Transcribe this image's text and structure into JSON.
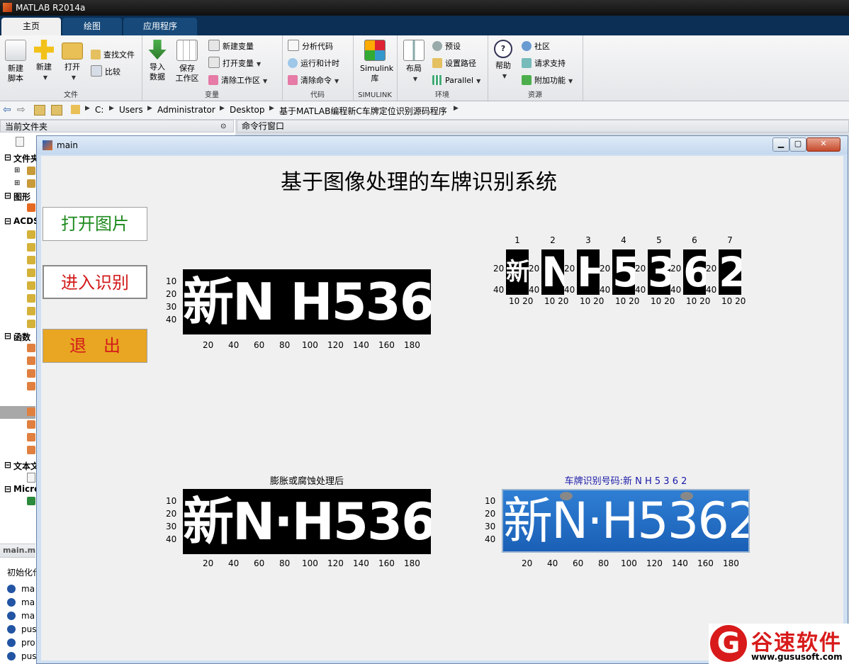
{
  "app": {
    "title": "MATLAB R2014a"
  },
  "tabs": [
    {
      "label": "主页",
      "active": true
    },
    {
      "label": "绘图",
      "active": false
    },
    {
      "label": "应用程序",
      "active": false
    }
  ],
  "ribbon": {
    "file": {
      "label": "文件",
      "new_script": "新建\n脚本",
      "new": "新建",
      "open": "打开",
      "find_files": "查找文件",
      "compare": "比较"
    },
    "variable": {
      "label": "变量",
      "import": "导入\n数据",
      "save": "保存\n工作区",
      "new_var": "新建变量",
      "open_var": "打开变量",
      "clear_ws": "清除工作区"
    },
    "code": {
      "label": "代码",
      "analyze": "分析代码",
      "run_time": "运行和计时",
      "clear_cmd": "清除命令"
    },
    "simulink": {
      "label": "SIMULINK",
      "lib": "Simulink\n库"
    },
    "env": {
      "label": "环境",
      "layout": "布局",
      "prefs": "预设",
      "set_path": "设置路径",
      "parallel": "Parallel"
    },
    "resources": {
      "label": "资源",
      "help": "帮助",
      "community": "社区",
      "support": "请求支持",
      "addons": "附加功能"
    }
  },
  "path": [
    "C:",
    "Users",
    "Administrator",
    "Desktop",
    "基于MATLAB编程新C车牌定位识别源码程序"
  ],
  "left_panel": {
    "title": "当前文件夹",
    "tree": [
      "文件夹",
      "图形",
      "ACDS",
      "函数",
      "文本文",
      "Micro"
    ],
    "file_header": "main.m",
    "init_text": "初始化代",
    "files": [
      "ma",
      "ma",
      "ma",
      "pus",
      "pro",
      "pus"
    ]
  },
  "command_window": {
    "title": "命令行窗口"
  },
  "figure": {
    "window_title": "main",
    "heading": "基于图像处理的车牌识别系统",
    "buttons": [
      {
        "label": "打开图片",
        "color": "#1e8a1e",
        "bg": "#ffffff"
      },
      {
        "label": "进入识别",
        "color": "#d21a1a",
        "bg": "#ffffff"
      },
      {
        "label": "退　出",
        "color": "#d21a1a",
        "bg": "#e9a622"
      }
    ],
    "plate_text": "新N H5362",
    "plate_text_dot": "新N·H5362",
    "axes_binary": {
      "yticks": [
        "10",
        "20",
        "30",
        "40"
      ],
      "xticks": [
        "20",
        "40",
        "60",
        "80",
        "100",
        "120",
        "140",
        "160",
        "180"
      ]
    },
    "axes_morph": {
      "title": "膨胀或腐蚀处理后",
      "yticks": [
        "10",
        "20",
        "30",
        "40"
      ],
      "xticks": [
        "20",
        "40",
        "60",
        "80",
        "100",
        "120",
        "140",
        "160",
        "180"
      ]
    },
    "axes_color": {
      "title": "车牌识别号码:新 N H 5 3 6 2",
      "title_color": "#1a1aa8",
      "yticks": [
        "10",
        "20",
        "30",
        "40"
      ],
      "xticks": [
        "20",
        "40",
        "60",
        "80",
        "100",
        "120",
        "140",
        "160",
        "180"
      ]
    },
    "segments": {
      "numbers": [
        "1",
        "2",
        "3",
        "4",
        "5",
        "6",
        "7"
      ],
      "chars": [
        "新",
        "N",
        "H",
        "5",
        "3",
        "6",
        "2"
      ],
      "yticks": [
        "20",
        "40"
      ],
      "xticks": "10 20"
    }
  },
  "watermark": {
    "letter": "G",
    "name": "谷速软件",
    "url": "www.gususoft.com"
  }
}
